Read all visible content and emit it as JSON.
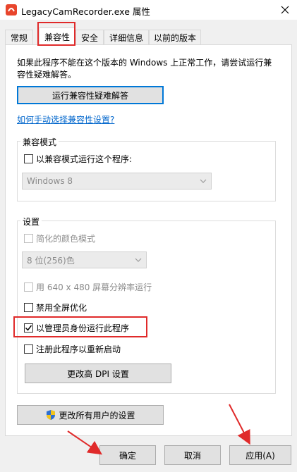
{
  "window": {
    "title": "LegacyCamRecorder.exe 属性"
  },
  "tabs": [
    {
      "label": "常规"
    },
    {
      "label": "兼容性"
    },
    {
      "label": "安全"
    },
    {
      "label": "详细信息"
    },
    {
      "label": "以前的版本"
    }
  ],
  "compat": {
    "intro_line1": "如果此程序不能在这个版本的 Windows 上正常工作，请尝试运行兼",
    "intro_line2": "容性疑难解答。",
    "troubleshoot_button": "运行兼容性疑难解答",
    "manual_link": "如何手动选择兼容性设置?",
    "mode_group": {
      "label": "兼容模式",
      "checkbox_label": "以兼容模式运行这个程序:",
      "select_value": "Windows 8"
    },
    "settings_group": {
      "label": "设置",
      "reduced_color": "简化的颜色模式",
      "color_select": "8 位(256)色",
      "res_640": "用 640 x 480 屏幕分辨率运行",
      "disable_fullscreen": "禁用全屏优化",
      "run_as_admin": "以管理员身份运行此程序",
      "register_restart": "注册此程序以重新启动",
      "dpi_button": "更改高 DPI 设置"
    },
    "all_users_button": "更改所有用户的设置"
  },
  "footer": {
    "ok": "确定",
    "cancel": "取消",
    "apply": "应用(A)"
  },
  "colors": {
    "highlight": "#e02a2a",
    "link": "#0066cc",
    "focus": "#0078d7"
  }
}
